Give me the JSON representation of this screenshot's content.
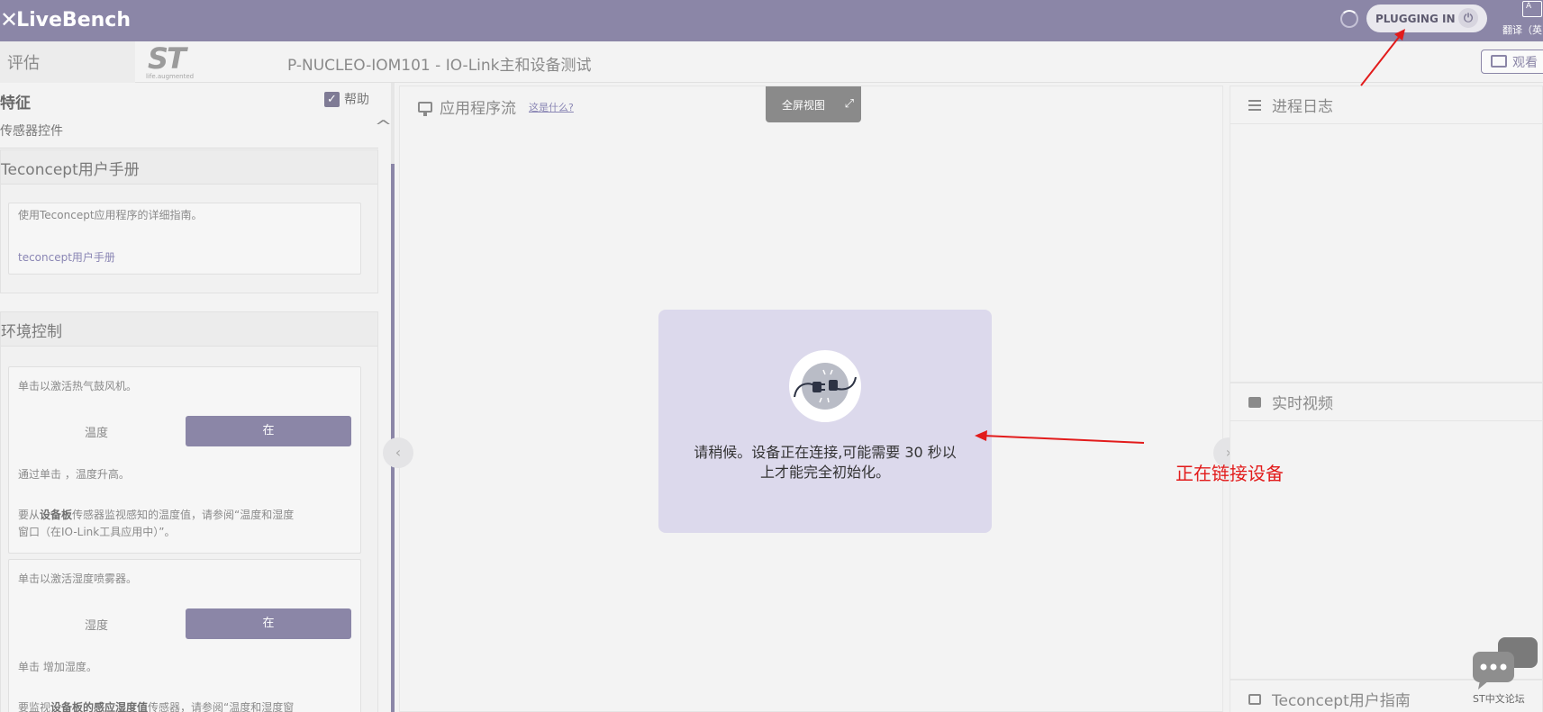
{
  "topbar": {
    "brand": "LiveBench",
    "plug_status": "PLUGGING IN",
    "translate_label": "翻译（英"
  },
  "subheader": {
    "tab": "评估",
    "logo_tag": "life.augmented",
    "title": "P-NUCLEO-IOM101 - IO-Link主和设备测试",
    "watch": "观看"
  },
  "left": {
    "feature_title": "特征",
    "help": "帮助",
    "sensor_controls": "传感器控件",
    "manual": {
      "header": "Teconcept用户手册",
      "desc": "使用Teconcept应用程序的详细指南。",
      "link": "teconcept用户手册"
    },
    "env": {
      "header": "环境控制",
      "card1": {
        "instruction": "单击以激活热气鼓风机。",
        "label": "温度",
        "button": "在",
        "note": "通过单击 ，温度升高。",
        "monitor_prefix": "要从",
        "monitor_bold": "设备板",
        "monitor_rest": "传感器监视感知的温度值，请参阅“温度和湿度",
        "monitor_line2": "窗口（在IO-Link工具应用中）”。"
      },
      "card2": {
        "instruction": "单击以激活湿度喷雾器。",
        "label": "湿度",
        "button": "在",
        "note": "单击 增加湿度。",
        "monitor_prefix": "要监视",
        "monitor_bold": "设备板的感应湿度值",
        "monitor_rest": "传感器，请参阅“温度和湿度窗"
      }
    }
  },
  "center": {
    "title": "应用程序流",
    "whatis": "这是什么?",
    "fullscreen": "全屏视图",
    "modal_line1": "请稍候。设备正在连接,可能需要 30 秒以",
    "modal_line2": "上才能完全初始化。"
  },
  "right": {
    "log_title": "进程日志",
    "video_title": "实时视频",
    "guide_title": "Teconcept用户指南"
  },
  "annotation": {
    "text": "正在链接设备",
    "color": "#e21b1b"
  },
  "forum": {
    "label": "ST中文论坛"
  },
  "colors": {
    "accent": "#8b86a7",
    "modal_bg": "#dcd9ec"
  }
}
